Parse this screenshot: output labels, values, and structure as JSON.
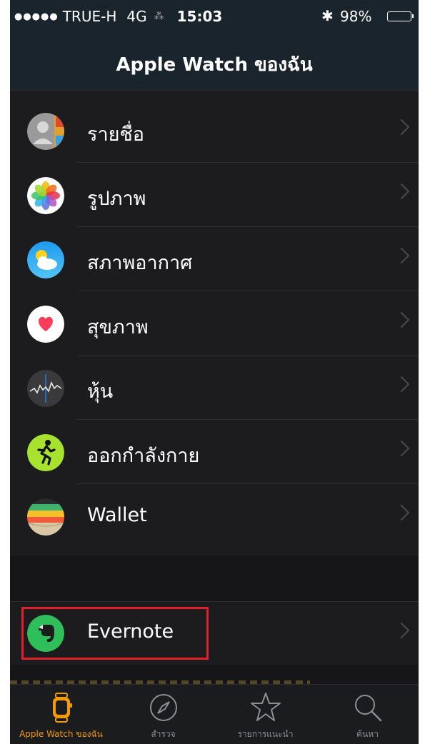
{
  "status_bar": {
    "signal": "●●●●●",
    "carrier": "TRUE-H",
    "network": "4G",
    "activity": "⁂",
    "time": "15:03",
    "bluetooth": "✱",
    "battery": "98%"
  },
  "nav": {
    "title": "Apple Watch ของฉัน"
  },
  "apps": [
    {
      "label": "รายชื่อ",
      "icon": "contacts-icon"
    },
    {
      "label": "รูปภาพ",
      "icon": "photos-icon"
    },
    {
      "label": "สภาพอากาศ",
      "icon": "weather-icon"
    },
    {
      "label": "สุขภาพ",
      "icon": "health-icon"
    },
    {
      "label": "หุ้น",
      "icon": "stocks-icon"
    },
    {
      "label": "ออกกำลังกาย",
      "icon": "workout-icon"
    },
    {
      "label": "Wallet",
      "icon": "wallet-icon"
    }
  ],
  "third_party": [
    {
      "label": "Evernote",
      "icon": "evernote-icon"
    }
  ],
  "tabs": [
    {
      "label": "Apple Watch ของฉัน",
      "icon": "watch-icon",
      "active": true
    },
    {
      "label": "สำรวจ",
      "icon": "compass-icon",
      "active": false
    },
    {
      "label": "รายการแนะนำ",
      "icon": "star-icon",
      "active": false
    },
    {
      "label": "ค้นหา",
      "icon": "search-icon",
      "active": false
    }
  ],
  "colors": {
    "accent": "#f59a00",
    "highlight": "#e0202a",
    "background": "#1c1c1e"
  }
}
